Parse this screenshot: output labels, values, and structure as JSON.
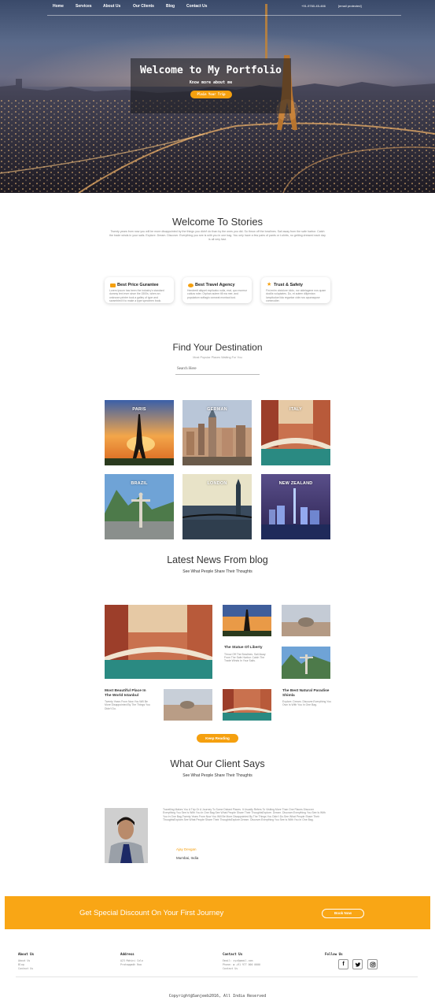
{
  "nav": {
    "items": [
      "Home",
      "Services",
      "About Us",
      "Our Clients",
      "Blog",
      "Contact Us"
    ],
    "phone": "+91-9760-45-466",
    "email": "[email protected]"
  },
  "hero": {
    "title": "Welcome to My Portfolio",
    "subtitle": "Know more about me",
    "button": "Plain Your Trip"
  },
  "stories": {
    "title": "Welcome To Stories",
    "text": "Twenty years from now you will be more disappointed by the things you didn't do than by the ones you did. So throw off the bowlines. Sail away from the safe harbor. Catch the trade winds in your sails. Explore. Dream. Discover. Everything you see is with you in one bag. You only have a few pairs of pants or t-shirts, no getting dressed each day is all very fast."
  },
  "features": [
    {
      "title": "Best Price Gurantee",
      "icon": "wallet-icon",
      "text": "Lorem Ipsum has been the industry's standard dummy text ever since the 1500s, when an unknown printer took a galley of type and scrambled it to make a type specimen book."
    },
    {
      "title": "Best Travel Agency",
      "icon": "heart-icon",
      "text": "Hendrerit aliquet explicabo nulla, erat, quo murmur cubiza roter. Orphan autem till ma mer, and populatum softagio conseat montaut iust."
    },
    {
      "title": "Trust & Safety",
      "icon": "star-icon",
      "text": "Fini enim obdolore idolo, nor aldelagene nos quam docilis voluptates. Do, et autem dilipentan lumpitudue lida reguntar cide nos apurasquse commodier."
    }
  ],
  "destinations": {
    "title": "Find Your Destination",
    "subtitle": "Most Popular Places Waiting For You",
    "search_placeholder": "Search Here",
    "items": [
      "PARIS",
      "GERMAN",
      "ITALY",
      "BRAZIL",
      "LONDON",
      "NEW ZEALAND"
    ]
  },
  "news": {
    "title": "Latest News From blog",
    "subtitle": "See What People Share Their Thoughts",
    "cards": [
      {
        "title": "The Statue Of Liberty",
        "text": "Throw Off The Bowlines. Sail Away From The Safe Harbor. Catch The Trade Winds In Your Sails."
      },
      {
        "title": "Most Beautiful Place In The World Istanbul",
        "text": "Twenty Years From Now You Will Be More Disappointed By The Things You Didn't Do."
      },
      {
        "title": "The Best Natural Paradise Shimla",
        "text": "Explore. Dream. Discover.Everything You Own Is With You In One Bag."
      }
    ],
    "button": "Keep Reading"
  },
  "clients": {
    "title": "What Our Client Says",
    "subtitle": "See What People Share Their Thoughts",
    "quote": "Travelling Makes You A Trip Or A Journey To Some Distant Places. It Usually Refers To Visiting More Than One Places Discover Everything You See Is With You In One Bag See What People Share Their ThoughtsExplore. Dream. Discover.Everything You See Is With You In One Bag.Twenty Years From Now You Will Be More Disappointed By The Things You Didn't Do.See What People Share Their ThoughtsExplore.See What People Share Their ThoughtsExplore.Dream. Discover.Everything You See Is With You In One Bag.",
    "name": "Ajay Devgan",
    "location": "Mumbai, India"
  },
  "banner": {
    "text": "Get Special Discount On Your First Journey",
    "button": "Book Now"
  },
  "footer": {
    "about": {
      "title": "About Us",
      "items": [
        "About Us",
        "Blog",
        "Contact Us"
      ]
    },
    "address": {
      "title": "Address",
      "items": [
        "A23 Mohini Colo",
        "Pratapgadh Roa"
      ]
    },
    "contact": {
      "title": "Contact Us",
      "items": [
        "Email: xyz@gmail.com",
        "Phone: ☎ +91 977 000 0000",
        "Contact Us"
      ]
    },
    "follow": {
      "title": "Follow Us",
      "icons": [
        "facebook-icon",
        "twitter-icon",
        "instagram-icon"
      ]
    },
    "copyright": "Copyright@Sanjeeb2016, All India Reserved"
  },
  "colors": {
    "accent": "#f5a00f",
    "banner": "#f9a615"
  }
}
